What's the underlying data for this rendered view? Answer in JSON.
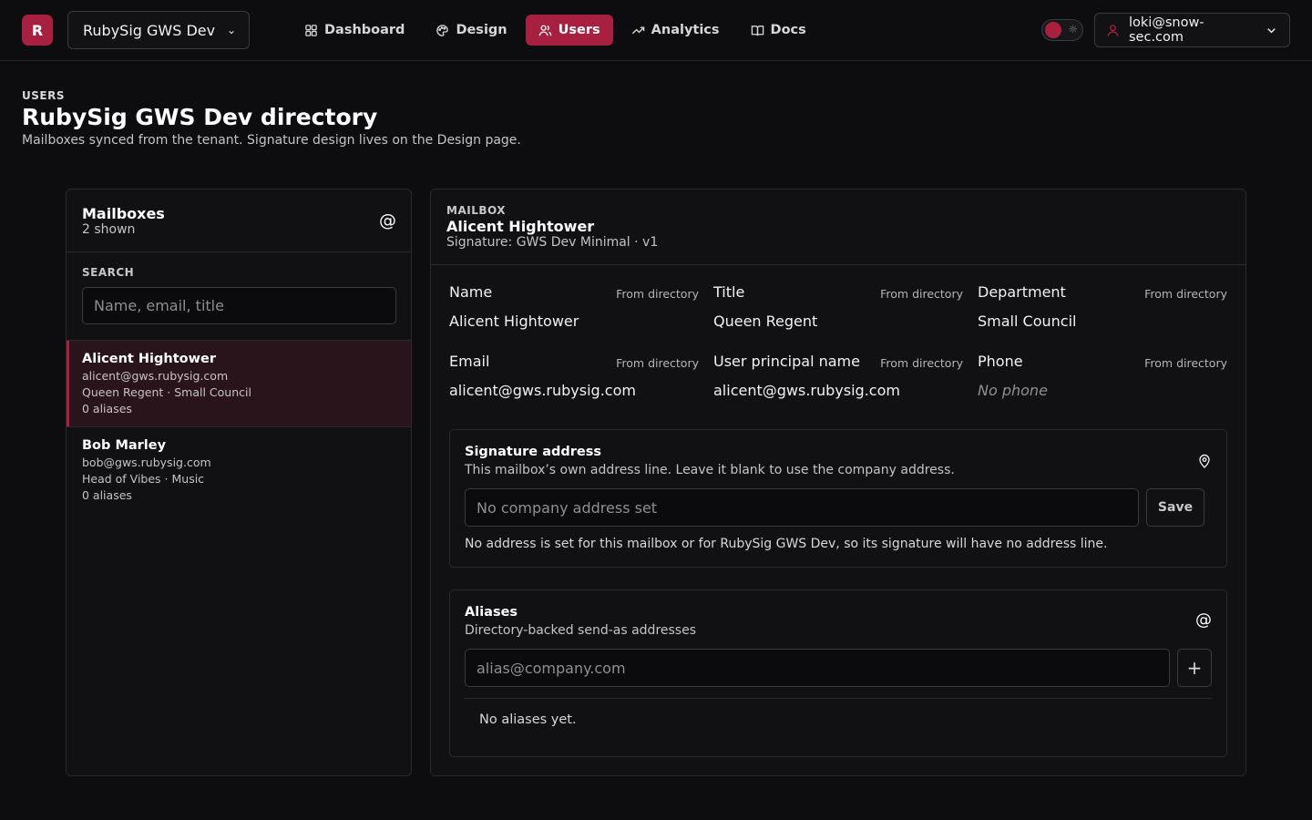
{
  "app": {
    "logo_letter": "R",
    "tenant": "RubySig GWS Dev",
    "accent": "#a8203f"
  },
  "nav": {
    "items": [
      {
        "label": "Dashboard",
        "icon": "grid-icon"
      },
      {
        "label": "Design",
        "icon": "palette-icon"
      },
      {
        "label": "Users",
        "icon": "users-icon",
        "active": true
      },
      {
        "label": "Analytics",
        "icon": "trending-up-icon"
      },
      {
        "label": "Docs",
        "icon": "book-icon"
      }
    ]
  },
  "account": {
    "email": "loki@snow-sec.com"
  },
  "page": {
    "eyebrow": "USERS",
    "title": "RubySig GWS Dev directory",
    "subtitle": "Mailboxes synced from the tenant. Signature design lives on the Design page."
  },
  "mailboxes": {
    "title": "Mailboxes",
    "count": "2 shown",
    "search_label": "SEARCH",
    "search_placeholder": "Name, email, title",
    "users": [
      {
        "name": "Alicent Hightower",
        "email": "alicent@gws.rubysig.com",
        "role": "Queen Regent · Small Council",
        "aliases": "0 aliases"
      },
      {
        "name": "Bob Marley",
        "email": "bob@gws.rubysig.com",
        "role": "Head of Vibes · Music",
        "aliases": "0 aliases"
      }
    ]
  },
  "detail": {
    "eyebrow": "MAILBOX",
    "name": "Alicent Hightower",
    "signature": "Signature: GWS Dev Minimal · v1",
    "fields": [
      {
        "label": "Name",
        "source": "From directory",
        "value": "Alicent Hightower"
      },
      {
        "label": "Title",
        "source": "From directory",
        "value": "Queen Regent"
      },
      {
        "label": "Department",
        "source": "From directory",
        "value": "Small Council"
      },
      {
        "label": "Email",
        "source": "From directory",
        "value": "alicent@gws.rubysig.com"
      },
      {
        "label": "User principal name",
        "source": "From directory",
        "value": "alicent@gws.rubysig.com"
      },
      {
        "label": "Phone",
        "source": "From directory",
        "value": "No phone"
      }
    ],
    "address": {
      "title": "Signature address",
      "description": "This mailbox’s own address line. Leave it blank to use the company address.",
      "placeholder": "No company address set",
      "save_label": "Save",
      "note": "No address is set for this mailbox or for RubySig GWS Dev, so its signature will have no address line."
    },
    "aliases": {
      "title": "Aliases",
      "description": "Directory-backed send-as addresses",
      "placeholder": "alias@company.com",
      "add_label": "+",
      "empty": "No aliases yet."
    }
  }
}
